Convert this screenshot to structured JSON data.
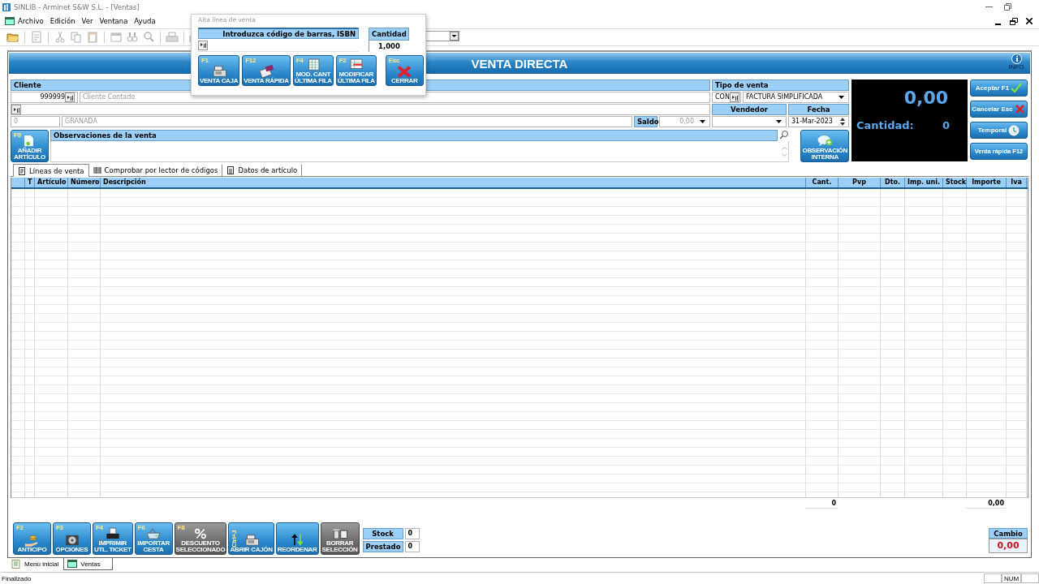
{
  "window": {
    "title": "SINLIB - Arminet S&W S.L. - [Ventas]"
  },
  "menu": [
    "Archivo",
    "Edición",
    "Ver",
    "Ventana",
    "Ayuda"
  ],
  "toolbar": [
    {
      "disabled": false
    },
    {
      "disabled": true
    },
    {
      "disabled": true
    },
    {
      "disabled": true
    },
    {
      "disabled": true
    },
    {
      "disabled": true
    },
    {
      "disabled": true
    },
    {
      "disabled": true
    },
    {
      "disabled": true
    },
    {
      "disabled": true
    }
  ],
  "form": {
    "title": "VENTA DIRECTA",
    "info_label": "INFO",
    "client": {
      "header": "Cliente",
      "code": "999999",
      "name": "Cliente Contado",
      "postal_code": "0",
      "city": "GRANADA",
      "balance_label": "Saldo",
      "balance": "0,00"
    },
    "sale_type": {
      "header": "Tipo de venta",
      "code": "CON",
      "type": "FACTURA SIMPLIFICADA",
      "seller_header": "Vendedor",
      "date_header": "Fecha",
      "date": "31-Mar-2023"
    },
    "add_item_button": {
      "key": "F9",
      "label": "AÑADIR\nARTÍCULO"
    },
    "notes": {
      "header": "Observaciones de la venta"
    },
    "internal_note_button": {
      "label": "OBSERVACIÓN\nINTERNA"
    },
    "display": {
      "total": "0,00",
      "quantity_label": "Cantidad:",
      "quantity": "0"
    },
    "actions": [
      {
        "label": "Aceptar F1"
      },
      {
        "label": "Cancelar Esc"
      },
      {
        "label": "Temporal"
      },
      {
        "label": "Venta rápida F12"
      }
    ],
    "tabs": [
      {
        "label": "Líneas de venta",
        "selected": true
      },
      {
        "label": "Comprobar por lector de códigos",
        "selected": false
      },
      {
        "label": "Datos de artículo",
        "selected": false
      }
    ],
    "table": {
      "columns": [
        "T",
        "Artículo",
        "Número",
        "Descripción",
        "Cant.",
        "Pvp",
        "Dto.",
        "Imp. uni.",
        "Stock",
        "Importe",
        "Iva"
      ]
    },
    "totals": {
      "quantity": "0",
      "amount": "0,00"
    },
    "bottom_buttons": [
      {
        "key": "F2",
        "label": "ANTICIPO",
        "disabled": false
      },
      {
        "key": "F3",
        "label": "OPCIONES",
        "disabled": false
      },
      {
        "key": "F4",
        "label": "IMPRIMIR\nUTL. TICKET",
        "disabled": false
      },
      {
        "key": "F6",
        "label": "IMPORTAR\nCESTA",
        "disabled": false
      },
      {
        "key": "F8",
        "label": "DESCUENTO\nSELECCIONADO",
        "disabled": true
      },
      {
        "key": "Ctrl+J",
        "label": "ABRIR CAJÓN",
        "disabled": false
      },
      {
        "label": "REORDENAR",
        "disabled": false
      },
      {
        "label": "BORRAR\nSELECCIÓN",
        "disabled": true
      }
    ],
    "stock": {
      "label": "Stock",
      "value": "0"
    },
    "loan": {
      "label": "Prestado",
      "value": "0"
    },
    "change": {
      "label": "Cambio",
      "value": "0,00"
    }
  },
  "popup": {
    "title": "Alta línea de venta",
    "barcode_header": "Introduzca código de barras, ISBN",
    "quantity_header": "Cantidad",
    "quantity": "1,000",
    "buttons": [
      {
        "key": "F1",
        "label": "VENTA CAJA"
      },
      {
        "key": "F12",
        "label": "VENTA RÁPIDA"
      },
      {
        "key": "F4",
        "label": "MOD. CANT\nÚLTIMA FILA"
      },
      {
        "key": "F2",
        "label": "MODIFICAR\nÚLTIMA FILA"
      },
      {
        "key": "Esc",
        "label": "CERRAR"
      }
    ]
  },
  "document_tabs": [
    {
      "label": "Menú inicial",
      "selected": false
    },
    {
      "label": "Ventas",
      "selected": true
    }
  ],
  "status_bar": {
    "message": "Finalizado",
    "indicators": [
      "NUM"
    ]
  }
}
